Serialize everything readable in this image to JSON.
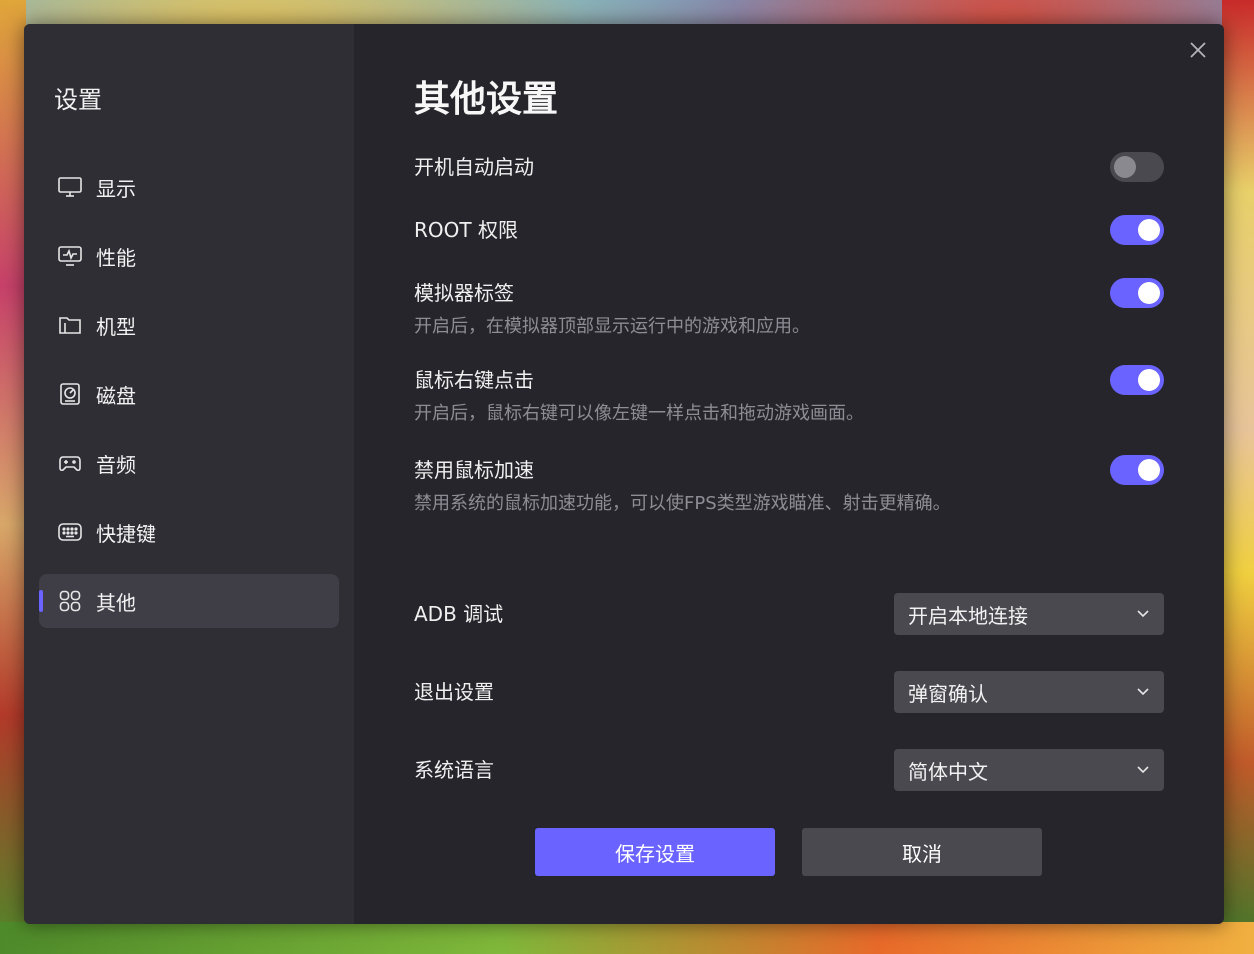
{
  "sidebar": {
    "title": "设置",
    "items": [
      {
        "label": "显示",
        "icon": "monitor-icon"
      },
      {
        "label": "性能",
        "icon": "performance-icon"
      },
      {
        "label": "机型",
        "icon": "folder-icon"
      },
      {
        "label": "磁盘",
        "icon": "disk-icon"
      },
      {
        "label": "音频",
        "icon": "gamepad-icon"
      },
      {
        "label": "快捷键",
        "icon": "keyboard-icon"
      },
      {
        "label": "其他",
        "icon": "grid-icon",
        "active": true
      }
    ]
  },
  "main": {
    "title": "其他设置",
    "toggles": [
      {
        "label": "开机自动启动",
        "on": false,
        "desc": ""
      },
      {
        "label": "ROOT 权限",
        "on": true,
        "desc": ""
      },
      {
        "label": "模拟器标签",
        "on": true,
        "desc": "开启后，在模拟器顶部显示运行中的游戏和应用。"
      },
      {
        "label": "鼠标右键点击",
        "on": true,
        "desc": "开启后，鼠标右键可以像左键一样点击和拖动游戏画面。"
      },
      {
        "label": "禁用鼠标加速",
        "on": true,
        "desc": "禁用系统的鼠标加速功能，可以使FPS类型游戏瞄准、射击更精确。"
      }
    ],
    "selects": [
      {
        "label": "ADB 调试",
        "value": "开启本地连接"
      },
      {
        "label": "退出设置",
        "value": "弹窗确认"
      },
      {
        "label": "系统语言",
        "value": "简体中文"
      }
    ],
    "save_label": "保存设置",
    "cancel_label": "取消"
  },
  "colors": {
    "accent": "#6a63ff",
    "dialog_bg": "#26252b",
    "sidebar_bg": "#2f2e35",
    "control_bg": "#4a4950"
  }
}
